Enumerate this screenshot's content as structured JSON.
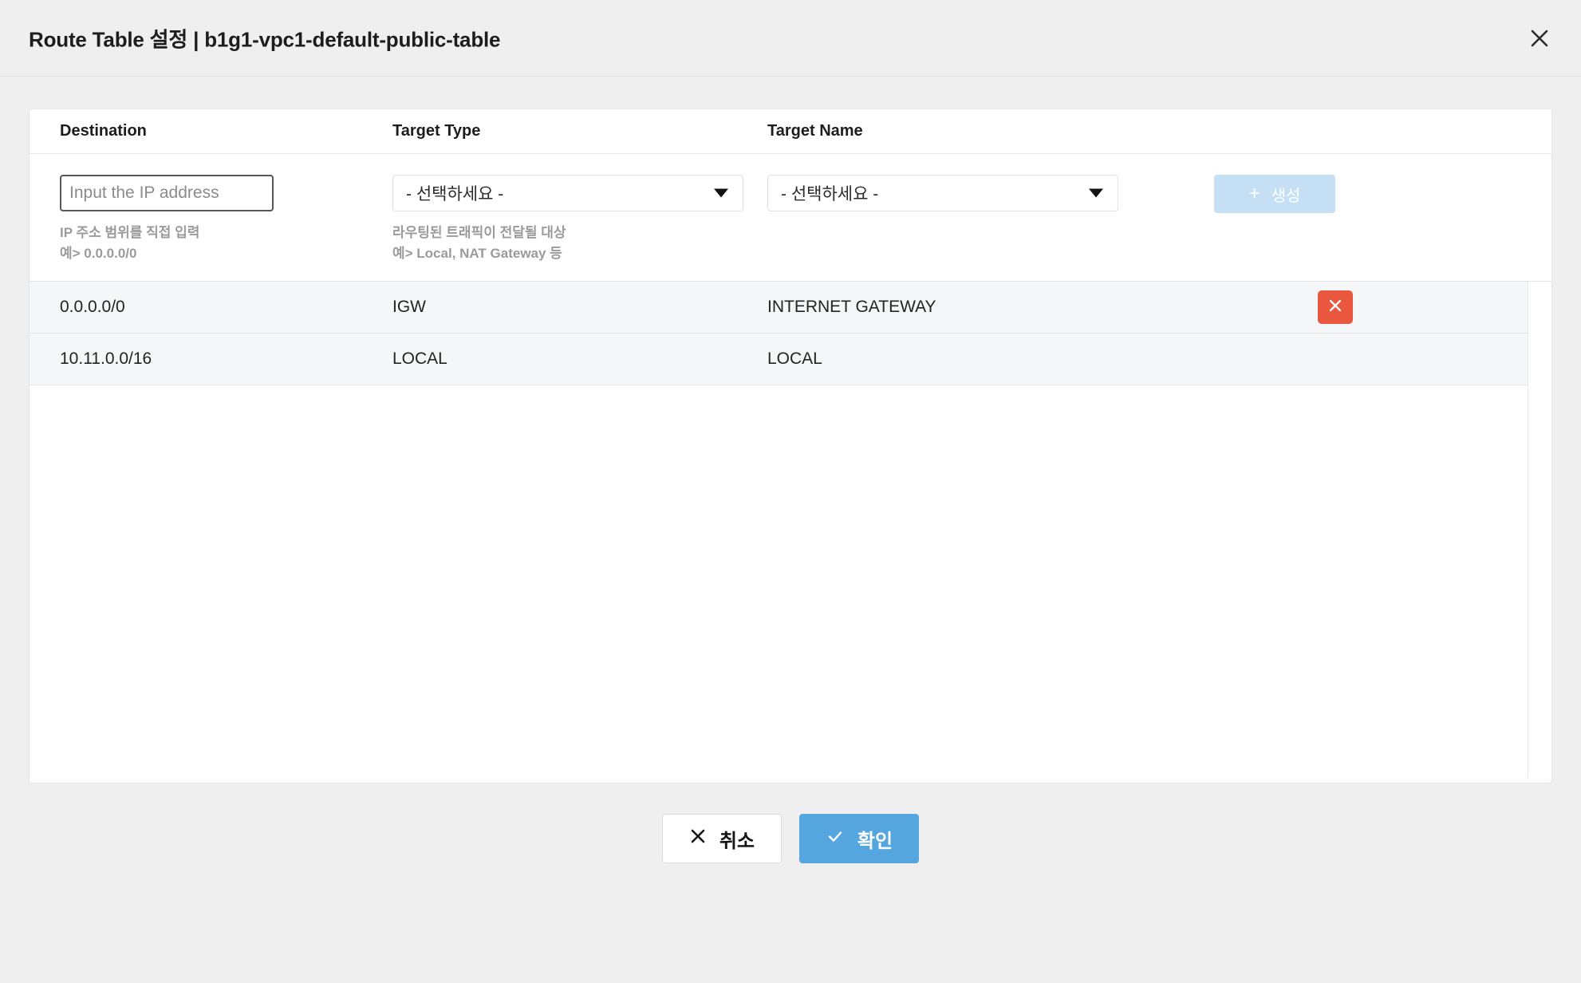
{
  "header": {
    "title": "Route Table 설정 | b1g1-vpc1-default-public-table",
    "close_icon": "close-icon"
  },
  "table": {
    "columns": [
      {
        "key": "destination",
        "label": "Destination"
      },
      {
        "key": "target_type",
        "label": "Target Type"
      },
      {
        "key": "target_name",
        "label": "Target Name"
      },
      {
        "key": "action",
        "label": ""
      }
    ],
    "rows": [
      {
        "destination": "0.0.0.0/0",
        "target_type": "IGW",
        "target_name": "INTERNET GATEWAY",
        "deletable": true
      },
      {
        "destination": "10.11.0.0/16",
        "target_type": "LOCAL",
        "target_name": "LOCAL",
        "deletable": false
      }
    ]
  },
  "form": {
    "destination": {
      "value": "",
      "placeholder": "Input the IP address",
      "helper_line1": "IP 주소 범위를 직접 입력",
      "helper_line2": "예> 0.0.0.0/0"
    },
    "target_type": {
      "selected": "- 선택하세요 -",
      "helper_line1": "라우팅된 트래픽이 전달될 대상",
      "helper_line2": "예> Local, NAT Gateway 등"
    },
    "target_name": {
      "selected": "- 선택하세요 -"
    },
    "create_button": {
      "label": "생성",
      "plus": "+",
      "disabled": true
    }
  },
  "footer": {
    "cancel_label": "취소",
    "confirm_label": "확인"
  },
  "colors": {
    "accent_blue": "#55a6de",
    "disabled_blue": "#c5e0f5",
    "danger_red": "#e9573f",
    "page_bg": "#efefef",
    "row_bg": "#f4f6f8"
  }
}
